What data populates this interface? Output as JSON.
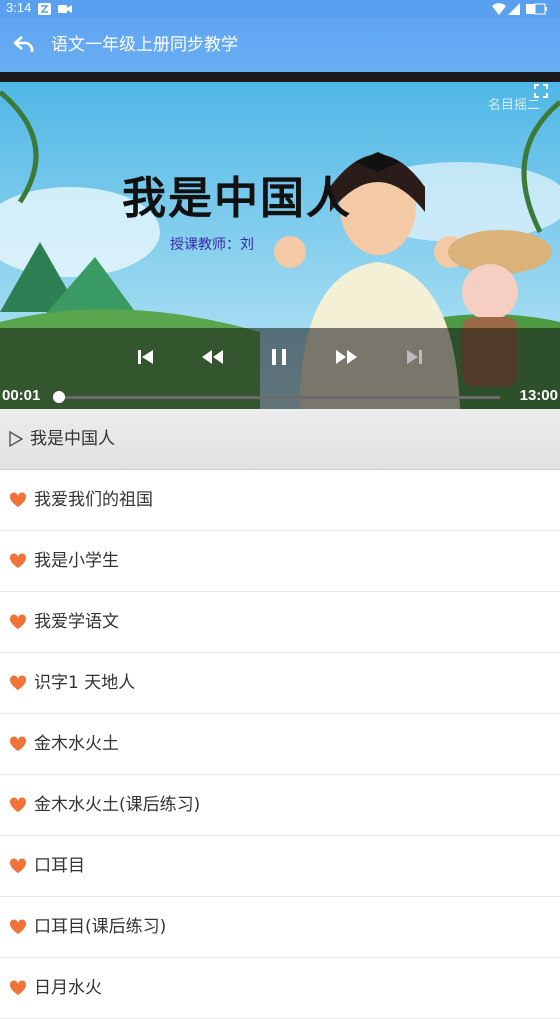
{
  "status_bar": {
    "time": "3:14"
  },
  "app_bar": {
    "title": "语文一年级上册同步教学"
  },
  "video": {
    "slide_title": "我是中国人",
    "slide_subtitle": "授课教师：刘",
    "watermark": "名目摇二",
    "current_time": "00:01",
    "total_time": "13:00",
    "progress_fraction": 0.003
  },
  "now_playing": {
    "label": "我是中国人"
  },
  "lessons": [
    {
      "label": "我爱我们的祖国"
    },
    {
      "label": "我是小学生"
    },
    {
      "label": "我爱学语文"
    },
    {
      "label": "识字1 天地人"
    },
    {
      "label": "金木水火土"
    },
    {
      "label": "金木水火土(课后练习)"
    },
    {
      "label": "口耳目"
    },
    {
      "label": "口耳目(课后练习)"
    },
    {
      "label": "日月水火"
    }
  ],
  "colors": {
    "accent": "#5aa0f0",
    "heart": "#f0733a"
  }
}
